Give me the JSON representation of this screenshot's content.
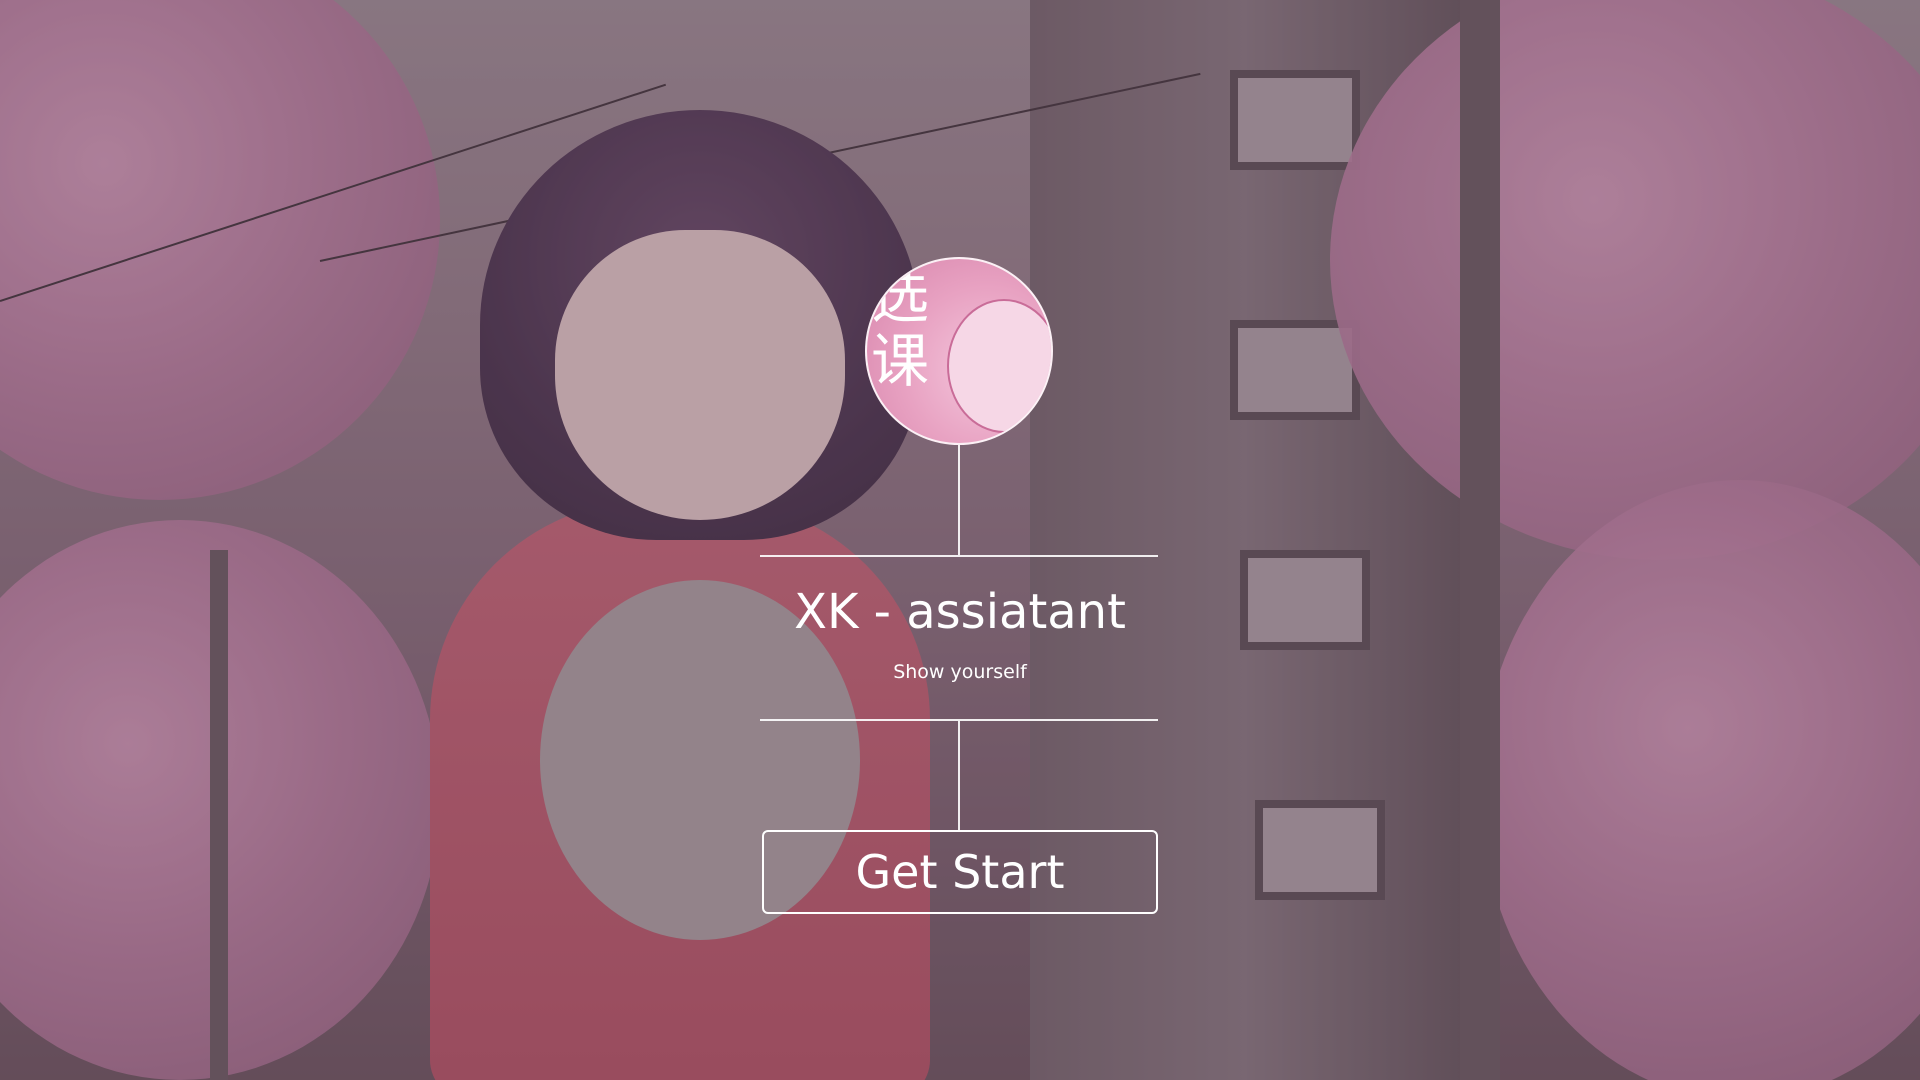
{
  "app": {
    "title": "XK - assiatant",
    "subtitle": "Show yourself"
  },
  "avatar": {
    "icon": "avatar-image",
    "glyph_text": "选课"
  },
  "actions": {
    "start_label": "Get Start"
  },
  "colors": {
    "text": "#ffffff",
    "avatar_bg": "#e8a2c2",
    "background_tint": "#8c6f7f"
  }
}
